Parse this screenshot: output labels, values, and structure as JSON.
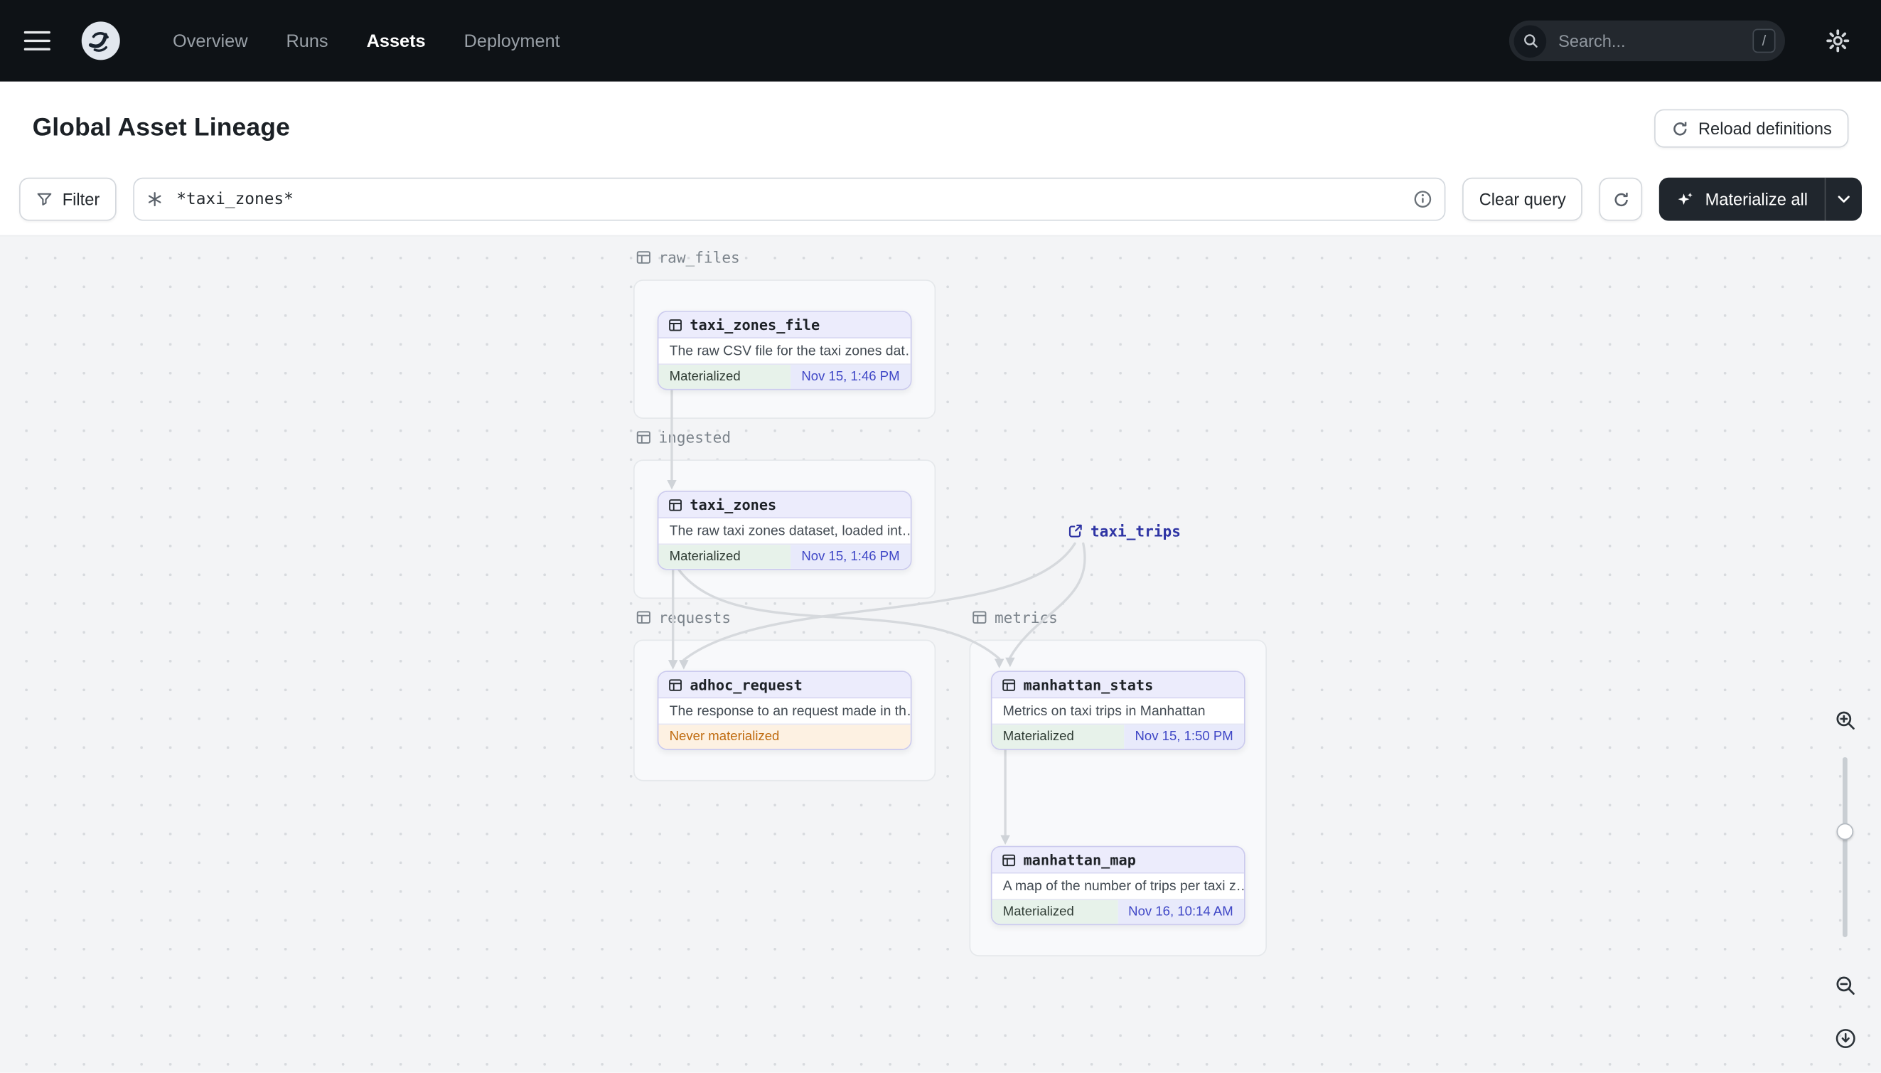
{
  "nav": {
    "items": [
      {
        "label": "Overview",
        "active": false
      },
      {
        "label": "Runs",
        "active": false
      },
      {
        "label": "Assets",
        "active": true
      },
      {
        "label": "Deployment",
        "active": false
      }
    ],
    "search": {
      "placeholder": "Search...",
      "shortcut": "/"
    }
  },
  "header": {
    "title": "Global Asset Lineage",
    "reload_button_label": "Reload definitions"
  },
  "toolbar": {
    "filter_label": "Filter",
    "query_value": "*taxi_zones*",
    "clear_query_label": "Clear query",
    "materialize_label": "Materialize all"
  },
  "graph": {
    "groups": [
      {
        "name": "raw_files"
      },
      {
        "name": "ingested"
      },
      {
        "name": "requests"
      },
      {
        "name": "metrics"
      }
    ],
    "nodes": [
      {
        "id": "taxi_zones_file",
        "group": "raw_files",
        "title": "taxi_zones_file",
        "description": "The raw CSV file for the taxi zones dat…",
        "status": "Materialized",
        "timestamp": "Nov 15, 1:46 PM"
      },
      {
        "id": "taxi_zones",
        "group": "ingested",
        "title": "taxi_zones",
        "description": "The raw taxi zones dataset, loaded int…",
        "status": "Materialized",
        "timestamp": "Nov 15, 1:46 PM"
      },
      {
        "id": "adhoc_request",
        "group": "requests",
        "title": "adhoc_request",
        "description": "The response to an request made in th…",
        "status": "Never materialized",
        "timestamp": ""
      },
      {
        "id": "manhattan_stats",
        "group": "metrics",
        "title": "manhattan_stats",
        "description": "Metrics on taxi trips in Manhattan",
        "status": "Materialized",
        "timestamp": "Nov 15, 1:50 PM"
      },
      {
        "id": "manhattan_map",
        "group": "metrics",
        "title": "manhattan_map",
        "description": "A map of the number of trips per taxi z…",
        "status": "Materialized",
        "timestamp": "Nov 16, 10:14 AM"
      }
    ],
    "external_assets": [
      {
        "title": "taxi_trips"
      }
    ],
    "edges": [
      {
        "from": "taxi_zones_file",
        "to": "taxi_zones"
      },
      {
        "from": "taxi_zones",
        "to": "adhoc_request"
      },
      {
        "from": "taxi_zones",
        "to": "manhattan_stats"
      },
      {
        "from": "taxi_trips",
        "to": "adhoc_request"
      },
      {
        "from": "taxi_trips",
        "to": "manhattan_stats"
      },
      {
        "from": "manhattan_stats",
        "to": "manhattan_map"
      }
    ]
  },
  "icons": {
    "menu-icon": "hamburger",
    "dagster-logo": "swirl",
    "search-icon": "magnifier",
    "gear-icon": "settings gear",
    "refresh-icon": "circular arrow",
    "filter-icon": "funnel",
    "op-selector-icon": "asterisk selector",
    "info-icon": "circled i",
    "sparkle-icon": "four point star",
    "caret-down-icon": "triangle down",
    "table-icon": "grid table",
    "external-link-icon": "box with arrow",
    "zoom-in-icon": "magnifier plus",
    "zoom-out-icon": "magnifier minus",
    "download-icon": "circled down arrow"
  },
  "colors": {
    "topbar_bg": "#0e1216",
    "dark_button_bg": "#20262d",
    "node_border": "#cbcaee",
    "node_header_bg": "#ececfc",
    "materialized_bg": "#e7f2ea",
    "timestamp_bg": "#e8eafb",
    "timestamp_text": "#3e46c6",
    "never_materialized_bg": "#fdf1e2",
    "never_materialized_text": "#bf6a0e",
    "canvas_bg": "#f3f4f6",
    "edge_color": "#d6d9dd",
    "external_asset_text": "#2e34a4"
  }
}
